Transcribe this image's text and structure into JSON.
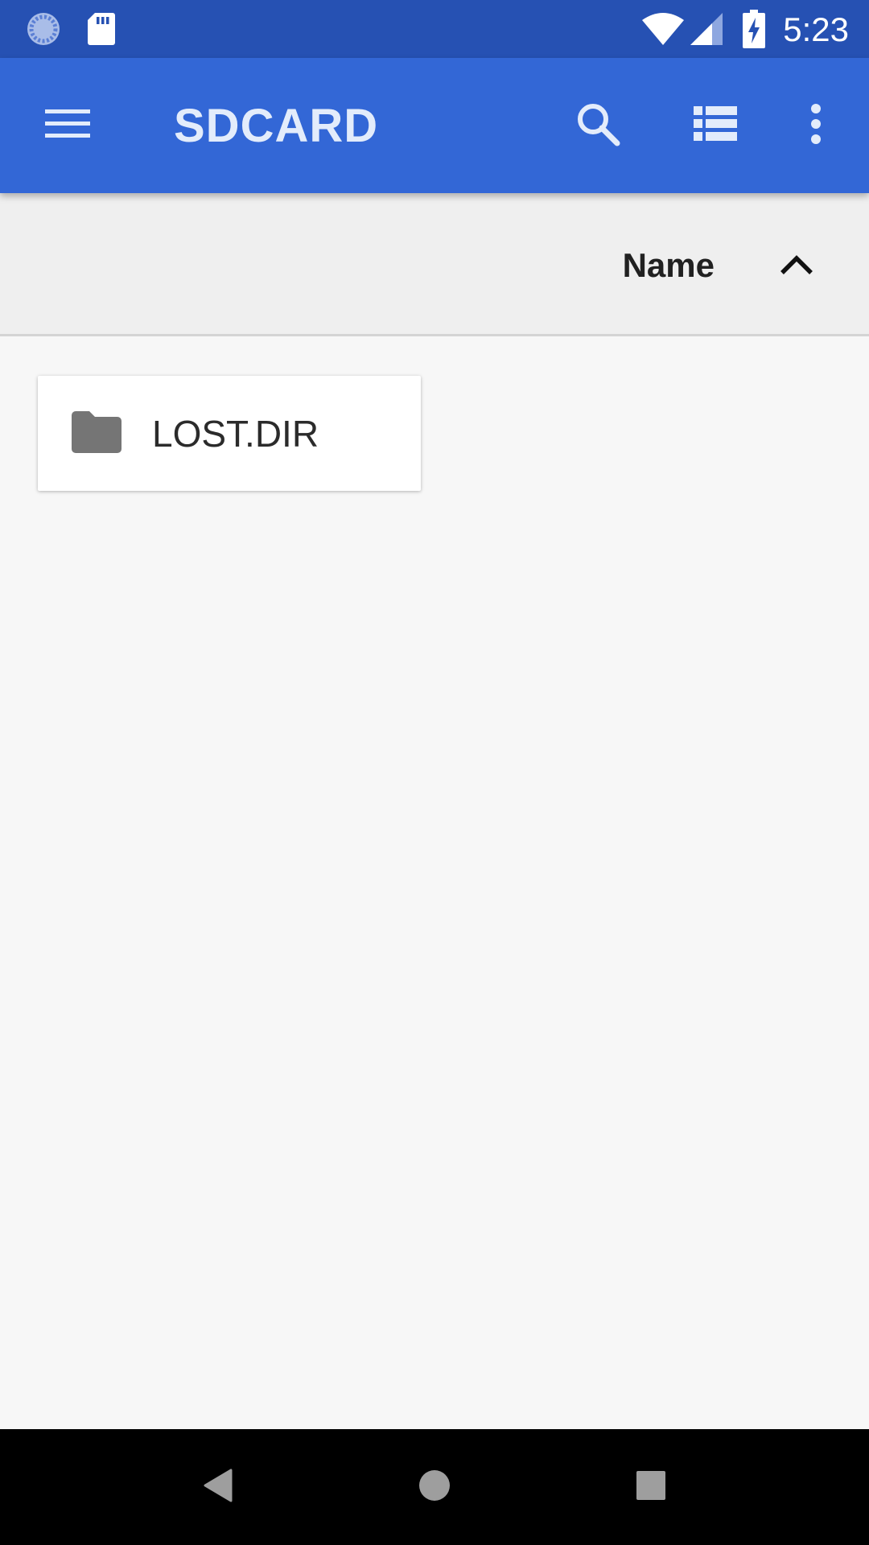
{
  "status_bar": {
    "time": "5:23",
    "icons": [
      "sync-icon",
      "sd-card-icon",
      "wifi-icon",
      "signal-icon",
      "battery-charging-icon"
    ]
  },
  "app_bar": {
    "title": "SDCARD",
    "actions": [
      "menu-icon",
      "search-icon",
      "list-view-icon",
      "more-vert-icon"
    ]
  },
  "sort_bar": {
    "label": "Name",
    "direction": "ascending"
  },
  "files": [
    {
      "name": "LOST.DIR",
      "type": "folder",
      "icon": "folder-icon"
    }
  ],
  "nav_bar": {
    "buttons": [
      "back-icon",
      "home-icon",
      "recents-icon"
    ]
  },
  "colors": {
    "status_bar": "#2651b3",
    "app_bar": "#3367d6",
    "title": "#e3ecfb",
    "sort_bar": "#efefef",
    "content": "#f7f7f7",
    "folder": "#757575"
  }
}
